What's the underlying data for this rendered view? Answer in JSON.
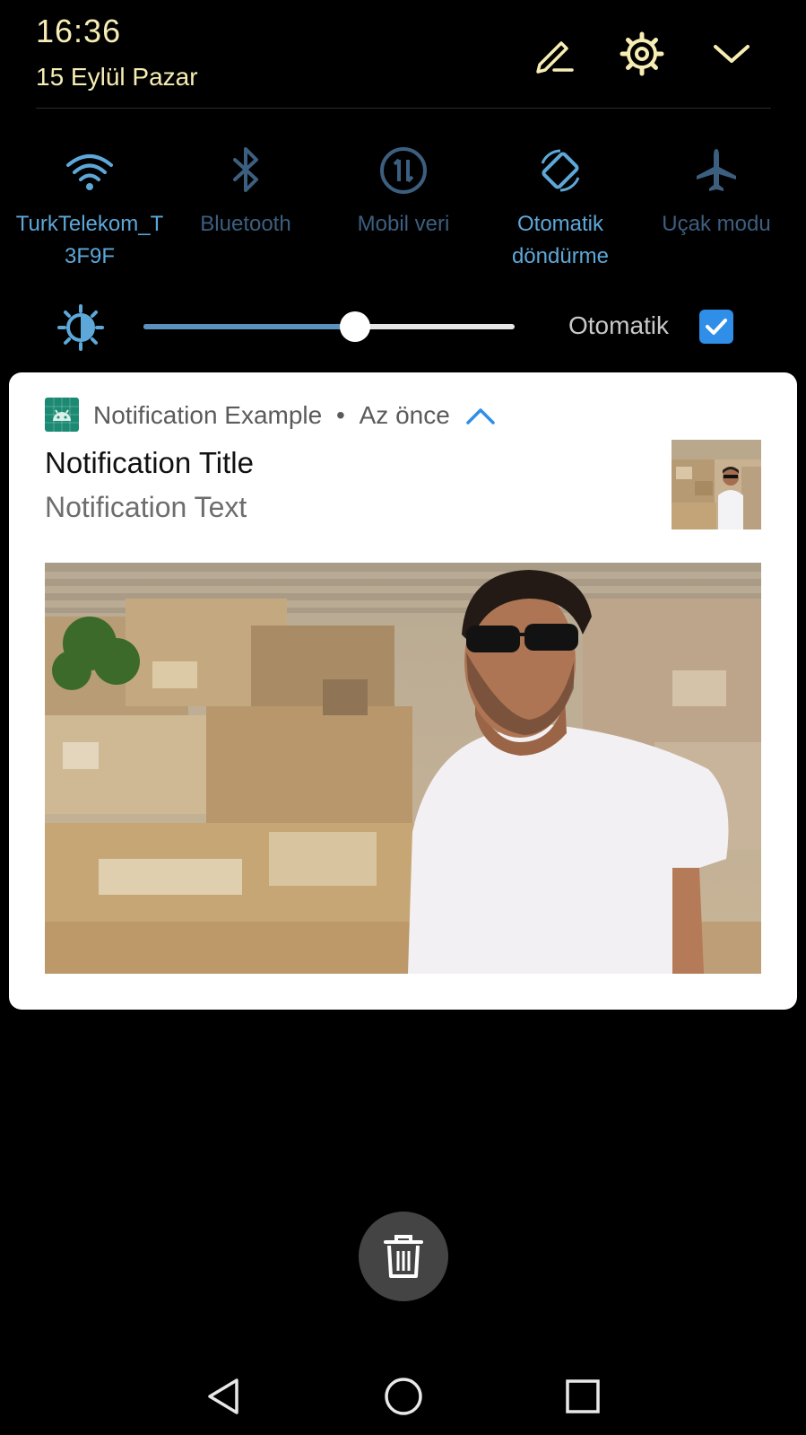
{
  "status": {
    "time": "16:36",
    "date": "15 Eylül Pazar"
  },
  "header_icons": [
    "edit-icon",
    "settings-icon",
    "collapse-chevron-icon"
  ],
  "quick_tiles": [
    {
      "id": "wifi",
      "label_line1": "TurkTelekom_T",
      "label_line2": "3F9F",
      "state": "on",
      "icon": "wifi-icon"
    },
    {
      "id": "bluetooth",
      "label_line1": "Bluetooth",
      "label_line2": "",
      "state": "off",
      "icon": "bluetooth-icon"
    },
    {
      "id": "mobile-data",
      "label_line1": "Mobil veri",
      "label_line2": "",
      "state": "off",
      "icon": "mobile-data-icon"
    },
    {
      "id": "auto-rotate",
      "label_line1": "Otomatik",
      "label_line2": "döndürme",
      "state": "on",
      "icon": "auto-rotate-icon"
    },
    {
      "id": "airplane",
      "label_line1": "Uçak modu",
      "label_line2": "",
      "state": "off",
      "icon": "airplane-icon"
    }
  ],
  "brightness": {
    "level": 0.57,
    "auto_label": "Otomatik",
    "auto_checked": true
  },
  "notification": {
    "app_name": "Notification Example",
    "separator": "•",
    "time": "Az önce",
    "title": "Notification Title",
    "text": "Notification Text",
    "expanded": true
  },
  "colors": {
    "clock_text": "#f6edb4",
    "tile_on": "#5da8d9",
    "tile_off": "#3c5f80",
    "checkbox": "#2f8ee8",
    "app_icon_bg": "#1c8a73"
  }
}
